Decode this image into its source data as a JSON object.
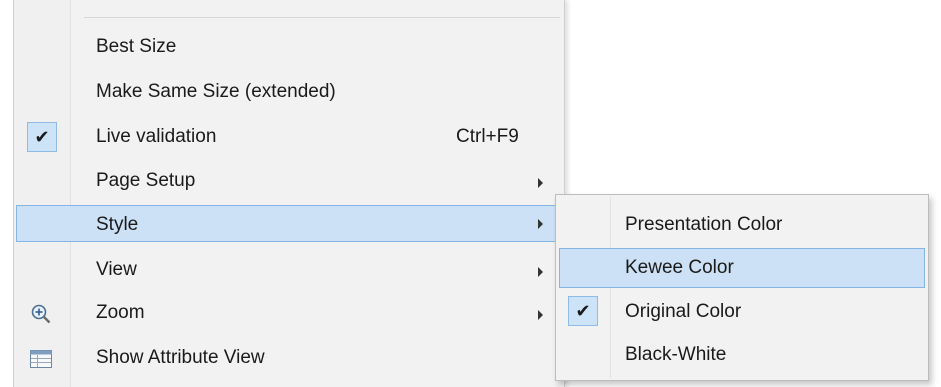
{
  "context_menu": {
    "items": [
      {
        "label": "Best Size"
      },
      {
        "label": "Make Same Size (extended)"
      },
      {
        "label": "Live validation",
        "shortcut": "Ctrl+F9",
        "checked": true
      },
      {
        "label": "Page Setup",
        "submenu": true
      },
      {
        "label": "Style",
        "submenu": true,
        "highlighted": true
      },
      {
        "label": "View",
        "submenu": true
      },
      {
        "label": "Zoom",
        "submenu": true,
        "icon": "zoom-in-icon"
      },
      {
        "label": "Show Attribute View",
        "icon": "table-view-icon"
      }
    ]
  },
  "style_submenu": {
    "items": [
      {
        "label": "Presentation Color"
      },
      {
        "label": "Kewee Color",
        "highlighted": true
      },
      {
        "label": "Original Color",
        "checked": true
      },
      {
        "label": "Black-White"
      }
    ]
  },
  "colors": {
    "highlight_bg": "#cce1f5",
    "highlight_border": "#85b5e4",
    "menu_bg": "#f2f2f2"
  }
}
